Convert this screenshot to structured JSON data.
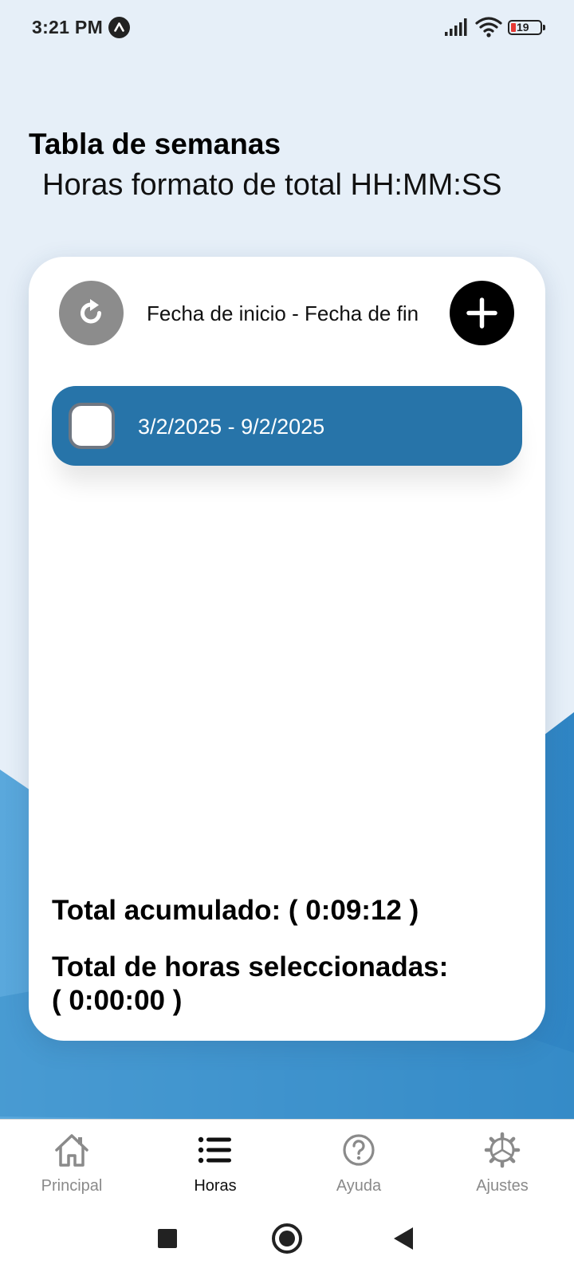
{
  "status_bar": {
    "time": "3:21 PM",
    "app_icon": "caret-up-badge-icon",
    "signal_icon": "cellular-signal-icon",
    "wifi_icon": "wifi-icon",
    "battery_level": "19"
  },
  "page": {
    "title": "Tabla de semanas",
    "subtitle": "Horas formato de total HH:MM:SS"
  },
  "card": {
    "refresh_icon": "refresh-icon",
    "header_label": "Fecha de inicio - Fecha de fin",
    "add_icon": "plus-icon",
    "weeks": [
      {
        "range": "3/2/2025 - 9/2/2025",
        "checked": false
      }
    ],
    "total_accumulated": "Total acumulado: ( 0:09:12 )",
    "total_selected_label": "Total de horas seleccionadas:",
    "total_selected_value": "( 0:00:00 )"
  },
  "bottom_nav": {
    "items": [
      {
        "label": "Principal",
        "icon": "home-icon",
        "active": false
      },
      {
        "label": "Horas",
        "icon": "list-icon",
        "active": true
      },
      {
        "label": "Ayuda",
        "icon": "help-circle-icon",
        "active": false
      },
      {
        "label": "Ajustes",
        "icon": "gear-icon",
        "active": false
      }
    ]
  },
  "colors": {
    "background": "#e6eff8",
    "wave_blue": "#3a8ecb",
    "week_row": "#2774a9",
    "add_button": "#000000",
    "refresh_button": "#8c8c8c"
  }
}
